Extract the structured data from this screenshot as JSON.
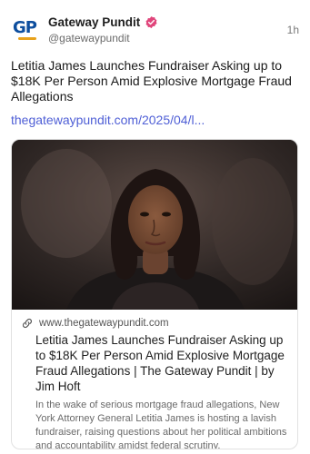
{
  "account": {
    "display_name": "Gateway Pundit",
    "handle": "@gatewaypundit",
    "avatar_letters": "GP",
    "verified_icon": "verified-badge-icon",
    "verified_color": "#e0457b"
  },
  "post": {
    "time": "1h",
    "text": "Letitia James Launches Fundraiser Asking up to $18K Per Person Amid Explosive Mortgage Fraud Allegations",
    "link_text": "thegatewaypundit.com/2025/04/l..."
  },
  "card": {
    "domain": "www.thegatewaypundit.com",
    "link_icon": "link-icon",
    "title": "Letitia James Launches Fundraiser Asking up to $18K Per Person Amid Explosive Mortgage Fraud Allegations | The Gateway Pundit | by Jim Hoft",
    "description": "In the wake of serious mortgage fraud allegations, New York Attorney General Letitia James is hosting a lavish fundraiser, raising questions about her political ambitions and accountability amidst federal scrutiny."
  },
  "colors": {
    "link": "#4f5fd6",
    "brand_blue": "#0d4e9e",
    "brand_orange": "#e8a21b"
  }
}
